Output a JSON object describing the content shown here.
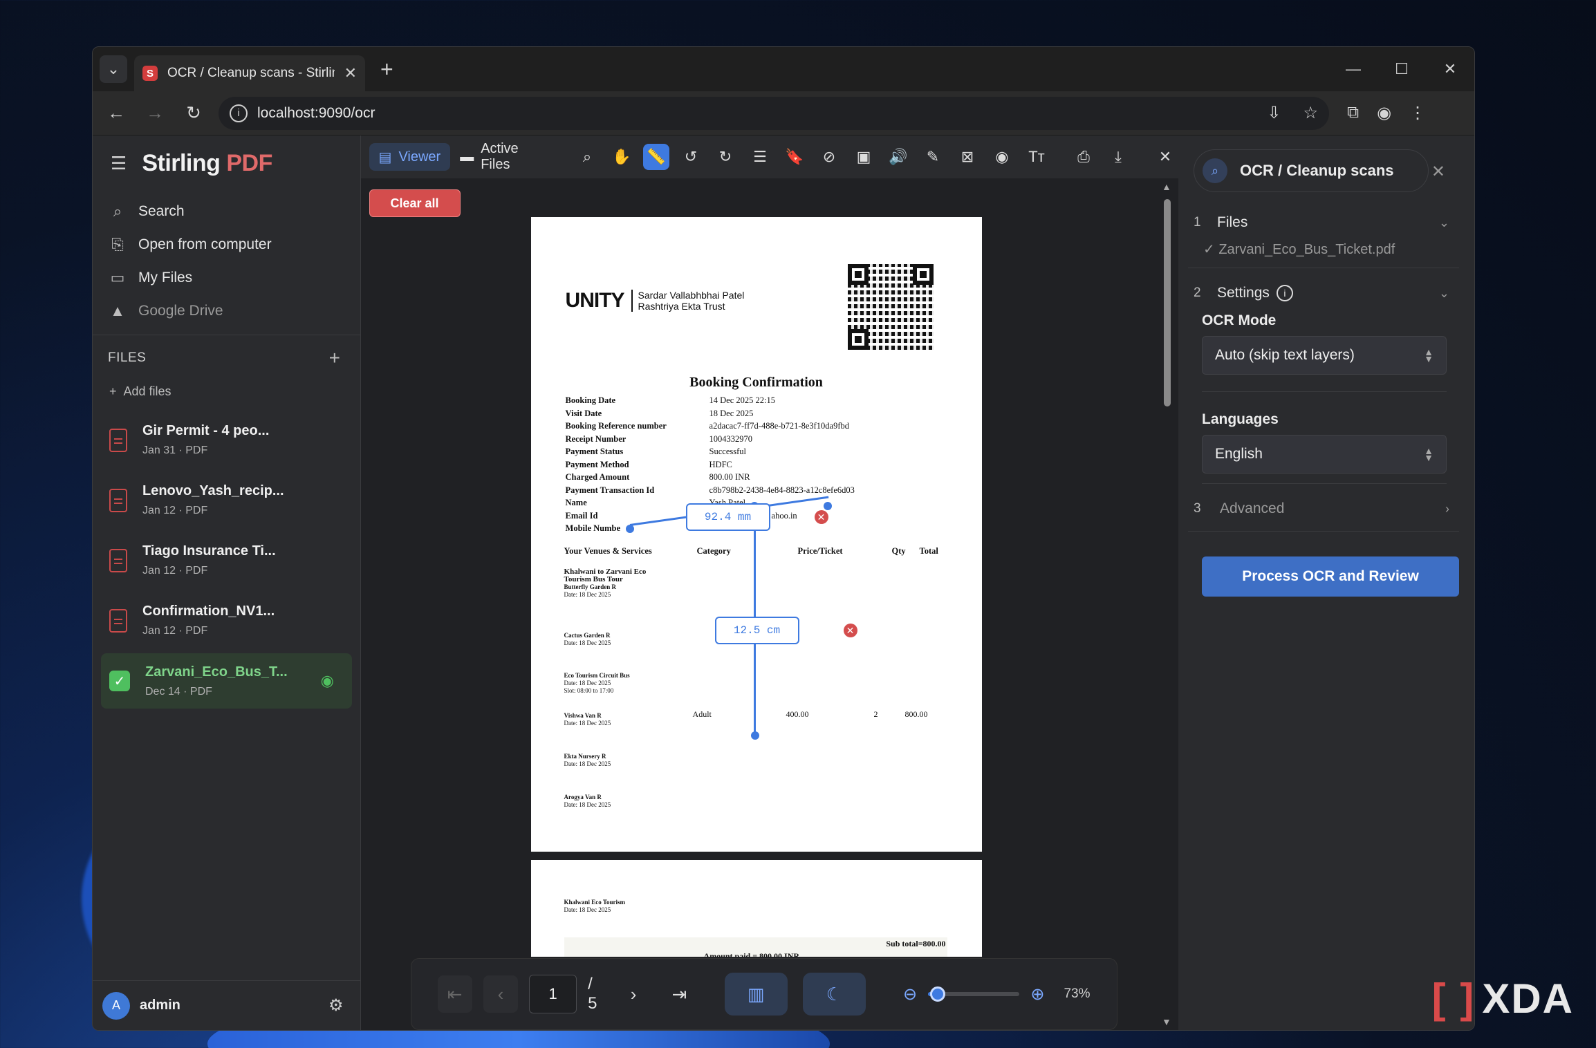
{
  "browser": {
    "tab_title": "OCR / Cleanup scans - Stirling PDF",
    "tab_favicon": "S",
    "url": "localhost:9090/ocr"
  },
  "app": {
    "brand_main": "Stirling",
    "brand_accent": "PDF",
    "nav": {
      "search": "Search",
      "open": "Open from computer",
      "my_files": "My Files",
      "drive": "Google Drive"
    },
    "files_heading": "FILES",
    "add_files": "Add files",
    "files": [
      {
        "name": "Gir Permit - 4 peo...",
        "meta": "Jan 31 · PDF"
      },
      {
        "name": "Lenovo_Yash_recip...",
        "meta": "Jan 12 · PDF"
      },
      {
        "name": "Tiago Insurance Ti...",
        "meta": "Jan 12 · PDF"
      },
      {
        "name": "Confirmation_NV1...",
        "meta": "Jan 12 · PDF"
      },
      {
        "name": "Zarvani_Eco_Bus_T...",
        "meta": "Dec 14 · PDF"
      }
    ],
    "user": {
      "initial": "A",
      "name": "admin"
    }
  },
  "viewer": {
    "tabs": {
      "viewer": "Viewer",
      "active_files": "Active Files"
    },
    "clear_all": "Clear all",
    "measure_1": "92.4 mm",
    "measure_2": "12.5 cm",
    "page_current": "1",
    "page_total": "/ 5",
    "zoom": "73%",
    "zoom_fraction": 0.1
  },
  "document": {
    "logo_mark": "UNITY",
    "logo_sub_1": "Sardar Vallabhbhai Patel",
    "logo_sub_2": "Rashtriya Ekta Trust",
    "title": "Booking Confirmation",
    "fields": [
      {
        "k": "Booking Date",
        "v": "14 Dec 2025 22:15"
      },
      {
        "k": "Visit Date",
        "v": "18 Dec 2025"
      },
      {
        "k": "Booking Reference number",
        "v": "a2dacac7-ff7d-488e-b721-8e3f10da9fbd"
      },
      {
        "k": "Receipt Number",
        "v": "1004332970"
      },
      {
        "k": "Payment Status",
        "v": "Successful"
      },
      {
        "k": "Payment Method",
        "v": "HDFC"
      },
      {
        "k": "Charged Amount",
        "v": "800.00 INR"
      },
      {
        "k": "Payment Transaction Id",
        "v": "c8b798b2-2438-4e84-8823-a12c8efe6d03"
      },
      {
        "k": "Name",
        "v": "Yash Patel"
      },
      {
        "k": "Email Id",
        "v": "ahoo.in"
      },
      {
        "k": "Mobile Numbe",
        "v": ""
      }
    ],
    "table_headers": {
      "venue": "Your Venues & Services",
      "category": "Category",
      "price": "Price/Ticket",
      "qty": "Qty",
      "total": "Total"
    },
    "services": [
      {
        "title": "Khalwani to Zarvani Eco Tourism Bus Tour",
        "sub": "Butterfly Garden R",
        "date": "Date: 18 Dec 2025"
      },
      {
        "title": "Cactus Garden R",
        "sub": "",
        "date": "Date: 18 Dec 2025"
      },
      {
        "title": "Eco Tourism Circuit Bus",
        "sub": "",
        "date": "Date: 18 Dec 2025",
        "slot": "Slot: 08:00 to 17:00"
      },
      {
        "title": "Vishwa Van R",
        "sub": "",
        "date": "Date: 18 Dec 2025"
      },
      {
        "title": "Ekta Nursery R",
        "sub": "",
        "date": "Date: 18 Dec 2025"
      },
      {
        "title": "Arogya Van R",
        "sub": "",
        "date": "Date: 18 Dec 2025"
      }
    ],
    "row_values": {
      "category": "Adult",
      "price": "400.00",
      "qty": "2",
      "total": "800.00"
    },
    "page2_title": "Khalwani Eco Tourism",
    "page2_date": "Date: 18 Dec 2025",
    "page2_subtotal": "Sub total=800.00",
    "page2_paid": "Amount paid = 800.00 INR"
  },
  "panel": {
    "tool_title": "OCR / Cleanup scans",
    "step1_num": "1",
    "step1_label": "Files",
    "step1_file": "✓ Zarvani_Eco_Bus_Ticket.pdf",
    "step2_num": "2",
    "step2_label": "Settings",
    "ocr_mode_label": "OCR Mode",
    "ocr_mode_value": "Auto (skip text layers)",
    "languages_label": "Languages",
    "languages_value": "English",
    "step3_num": "3",
    "step3_label": "Advanced",
    "process_button": "Process OCR and Review"
  },
  "watermark": "XDA"
}
